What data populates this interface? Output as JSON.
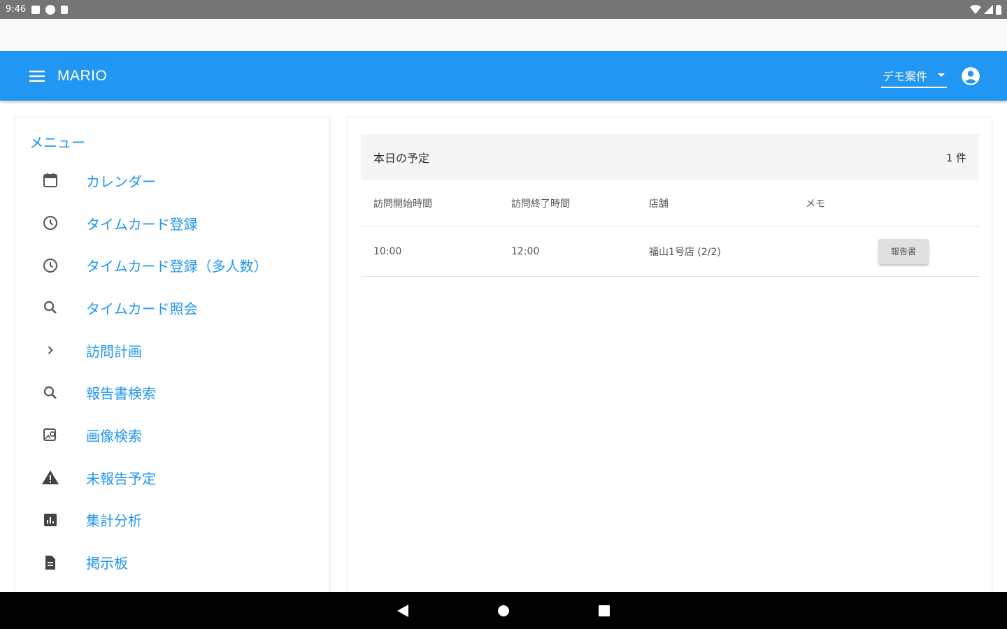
{
  "status_bar": {
    "time": "9:46"
  },
  "app_bar": {
    "title": "MARIO",
    "project": "デモ案件"
  },
  "menu": {
    "heading": "メニュー",
    "items": [
      {
        "label": "カレンダー",
        "icon": "calendar-icon"
      },
      {
        "label": "タイムカード登録",
        "icon": "clock-icon"
      },
      {
        "label": "タイムカード登録（多人数）",
        "icon": "clock-icon"
      },
      {
        "label": "タイムカード照会",
        "icon": "search-icon"
      },
      {
        "label": "訪問計画",
        "icon": "chevron-right-icon"
      },
      {
        "label": "報告書検索",
        "icon": "search-icon"
      },
      {
        "label": "画像検索",
        "icon": "image-search-icon"
      },
      {
        "label": "未報告予定",
        "icon": "warning-icon"
      },
      {
        "label": "集計分析",
        "icon": "chart-icon"
      },
      {
        "label": "掲示板",
        "icon": "document-icon"
      }
    ]
  },
  "schedule": {
    "title": "本日の予定",
    "count": "1 件",
    "columns": [
      "訪問開始時間",
      "訪問終了時間",
      "店舗",
      "メモ"
    ],
    "rows": [
      {
        "start": "10:00",
        "end": "12:00",
        "store": "福山1号店 (2/2)",
        "memo": "",
        "action": "報告書"
      }
    ]
  },
  "colors": {
    "primary": "#2196f3",
    "status_bar": "#757575",
    "nav_bar": "#000000"
  }
}
